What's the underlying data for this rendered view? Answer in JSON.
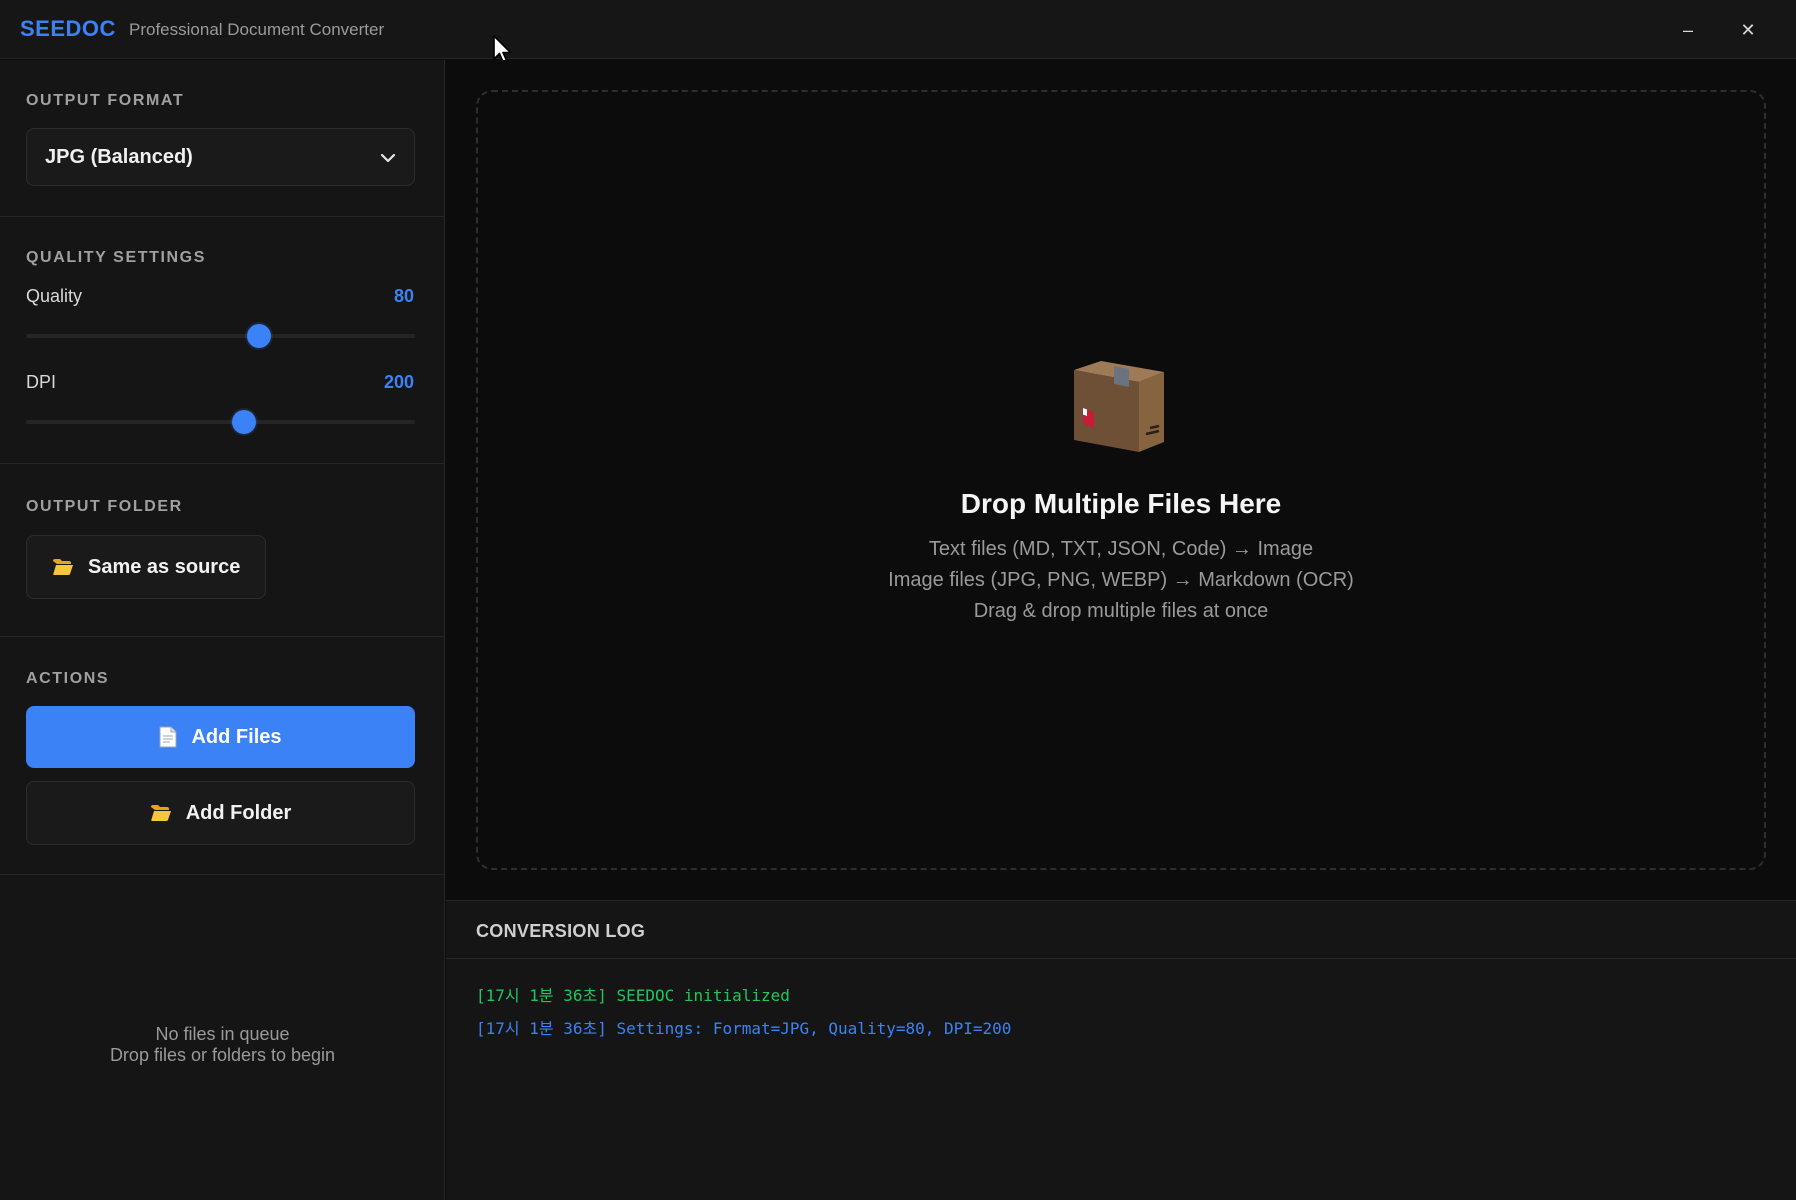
{
  "app": {
    "brand": "SEEDOC",
    "subtitle": "Professional Document Converter"
  },
  "window_controls": {
    "minimize": "–",
    "close": "✕"
  },
  "sidebar": {
    "output_format": {
      "title": "OUTPUT FORMAT",
      "selected": "JPG (Balanced)"
    },
    "quality_settings": {
      "title": "QUALITY SETTINGS",
      "quality": {
        "label": "Quality",
        "value": "80",
        "fraction": 0.6
      },
      "dpi": {
        "label": "DPI",
        "value": "200",
        "fraction": 0.56
      }
    },
    "output_folder": {
      "title": "OUTPUT FOLDER",
      "button": "Same as source"
    },
    "actions": {
      "title": "ACTIONS",
      "add_files": "Add Files",
      "add_folder": "Add Folder"
    },
    "queue": {
      "empty_line1": "No files in queue",
      "empty_line2": "Drop files or folders to begin"
    }
  },
  "dropzone": {
    "icon": "package-icon",
    "title": "Drop Multiple Files Here",
    "line1": "Text files (MD, TXT, JSON, Code) → Image",
    "line2": "Image files (JPG, PNG, WEBP) → Markdown (OCR)",
    "line3": "Drag & drop multiple files at once"
  },
  "log": {
    "title": "CONVERSION LOG",
    "entries": [
      {
        "text": "[17시 1분 36초] SEEDOC initialized",
        "color": "#22c55e"
      },
      {
        "text": "[17시 1분 36초] Settings: Format=JPG, Quality=80, DPI=200",
        "color": "#3b82f6"
      }
    ]
  },
  "colors": {
    "accent": "#3b82f6",
    "success": "#22c55e",
    "background": "#0c0c0c",
    "panel": "#151515"
  }
}
